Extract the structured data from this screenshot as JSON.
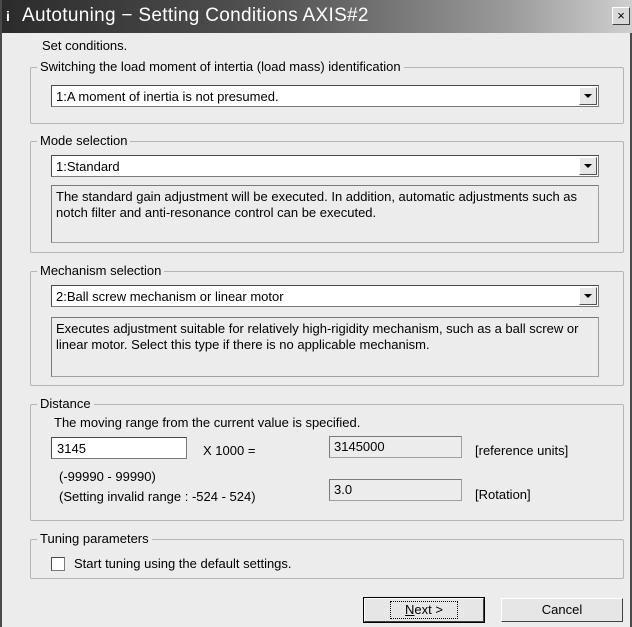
{
  "window": {
    "title": "Autotuning − Setting Conditions AXIS#2",
    "title_icon": "i",
    "close_label": "×"
  },
  "intro": "Set conditions.",
  "identification": {
    "legend": "Switching the load moment of intertia (load mass) identification",
    "selected": "1:A moment of inertia is not presumed."
  },
  "mode": {
    "legend": "Mode selection",
    "selected": "1:Standard",
    "description": "The standard gain adjustment will be executed. In addition, automatic adjustments such as notch filter and anti-resonance control can be executed."
  },
  "mechanism": {
    "legend": "Mechanism selection",
    "selected": "2:Ball screw mechanism or linear motor",
    "description": "Executes adjustment suitable for relatively high-rigidity mechanism, such as a ball screw or linear motor. Select this type if there is no applicable mechanism."
  },
  "distance": {
    "legend": "Distance",
    "note": "The moving range from the current value is specified.",
    "input_value": "3145",
    "multiplier": "X 1000 =",
    "result_value": "3145000",
    "result_unit": "[reference units]",
    "range_text": "(-99990 - 99990)",
    "invalid_range_text": "(Setting invalid range : -524 - 524)",
    "rotation_value": "3.0",
    "rotation_unit": "[Rotation]"
  },
  "tuning": {
    "legend": "Tuning parameters",
    "checkbox_label": "Start tuning using the default settings.",
    "checked": false
  },
  "buttons": {
    "next_mnemonic": "N",
    "next_rest": "ext >",
    "cancel": "Cancel"
  }
}
